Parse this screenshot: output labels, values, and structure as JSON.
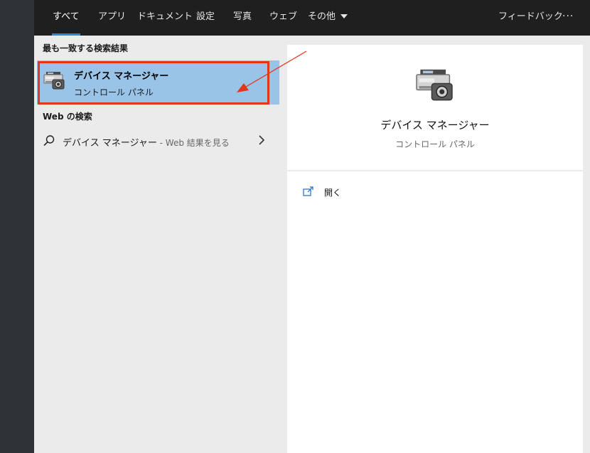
{
  "tabs": [
    {
      "label": "すべて",
      "active": true
    },
    {
      "label": "アプリ"
    },
    {
      "label": "ドキュメント"
    },
    {
      "label": "設定"
    },
    {
      "label": "写真"
    },
    {
      "label": "ウェブ"
    },
    {
      "label": "その他"
    }
  ],
  "feedback_label": "フィードバック",
  "more_label": "···",
  "best_match": {
    "section_title": "最も一致する検索結果",
    "title": "デバイス マネージャー",
    "subtitle": "コントロール パネル",
    "icon": "device-manager-icon"
  },
  "web_search": {
    "section_title": "Web の検索",
    "query": "デバイス マネージャー",
    "hint": " - Web 結果を見る",
    "icon": "search-icon"
  },
  "detail": {
    "title": "デバイス マネージャー",
    "subtitle": "コントロール パネル",
    "open_label": "開く",
    "open_icon": "open-external-icon"
  },
  "colors": {
    "topbar": "#1f1f1f",
    "accent": "#2a86d8",
    "pane": "#ebebeb",
    "selection": "#99c4e8",
    "annotation": "#e3361c"
  }
}
